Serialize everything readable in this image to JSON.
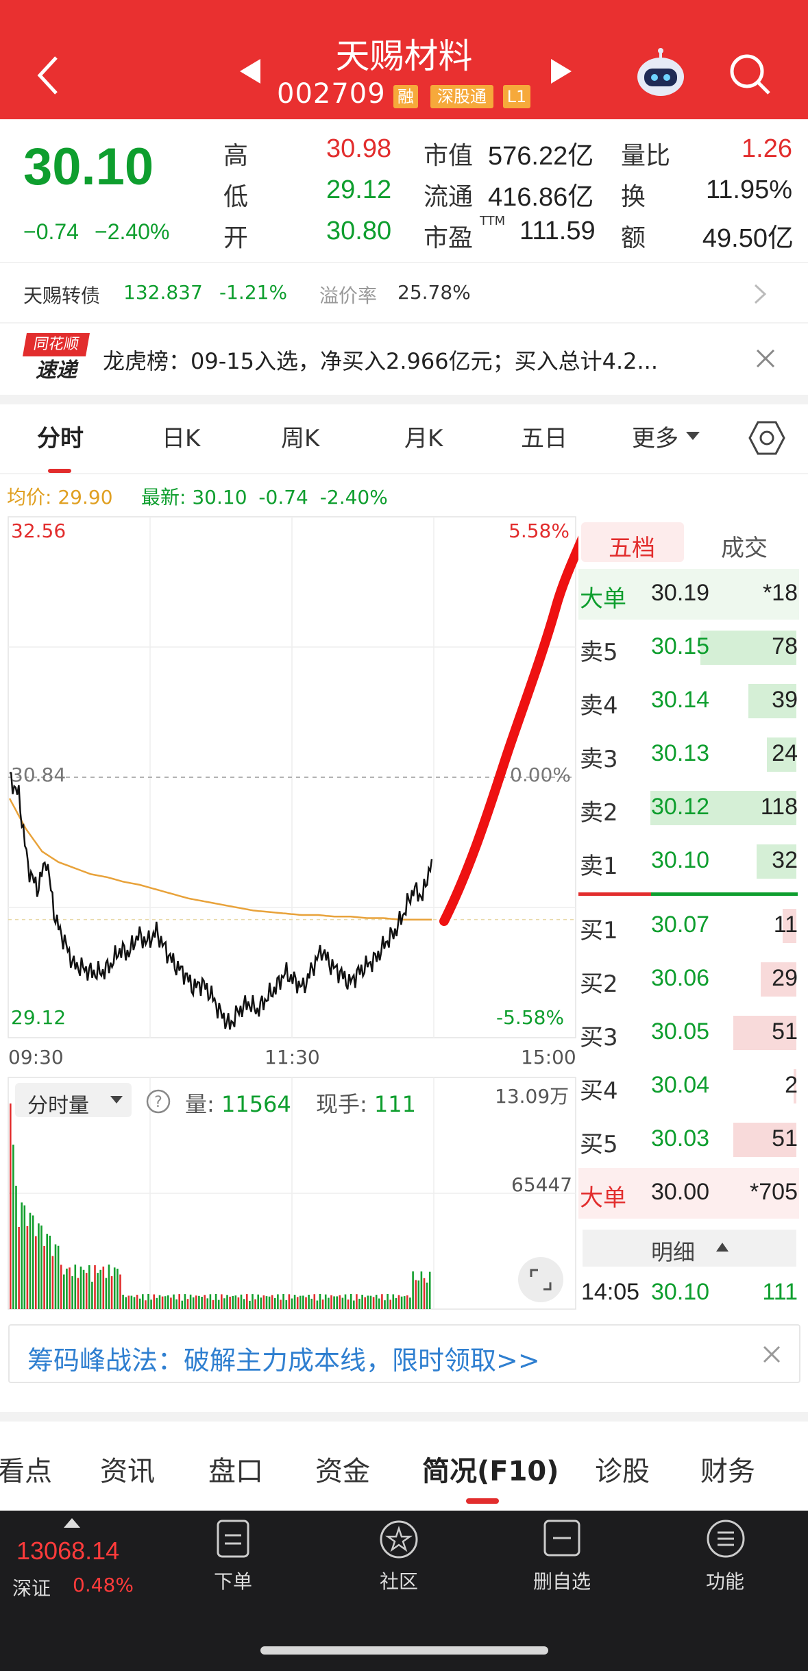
{
  "header": {
    "title": "天赐材料",
    "code": "002709",
    "tags": [
      "融",
      "深股通",
      "L1"
    ],
    "colors": {
      "bg": "#e93030",
      "tag": "#f6a93b"
    }
  },
  "quote": {
    "price": "30.10",
    "change": "−0.74",
    "change_pct": "−2.40%",
    "high_label": "高",
    "high": "30.98",
    "low_label": "低",
    "low": "29.12",
    "open_label": "开",
    "open": "30.80",
    "mcap_label": "市值",
    "mcap": "576.22亿",
    "float_label": "流通",
    "float": "416.86亿",
    "pe_label": "市盈",
    "pe_sup": "TTM",
    "pe": "111.59",
    "vol_ratio_label": "量比",
    "vol_ratio": "1.26",
    "turnover_label": "换",
    "turnover": "11.95%",
    "amount_label": "额",
    "amount": "49.50亿"
  },
  "bond": {
    "name": "天赐转债",
    "price": "132.837",
    "pct": "-1.21%",
    "premium_label": "溢价率",
    "premium": "25.78%"
  },
  "news": {
    "badge_line1": "同花顺",
    "badge_line2": "速递",
    "text": "龙虎榜：09-15入选，净买入2.966亿元；买入总计4.2..."
  },
  "tabs": [
    "分时",
    "日K",
    "周K",
    "月K",
    "五日",
    "更多"
  ],
  "chart_info": {
    "avg_label": "均价:",
    "avg": "29.90",
    "latest_label": "最新:",
    "latest": "30.10",
    "chg": "-0.74",
    "pct": "-2.40%"
  },
  "chart_data": {
    "type": "line",
    "y_top": "32.56",
    "y_mid": "30.84",
    "y_bottom": "29.12",
    "pct_top": "5.58%",
    "pct_mid": "0.00%",
    "pct_bottom": "-5.58%",
    "ylim": [
      29.12,
      32.56
    ],
    "x_ticks": [
      "09:30",
      "11:30",
      "15:00"
    ],
    "price_series": [
      30.84,
      30.72,
      30.25,
      30.1,
      30.3,
      29.9,
      29.75,
      29.6,
      29.58,
      29.55,
      29.55,
      29.6,
      29.7,
      29.68,
      29.8,
      29.75,
      29.82,
      29.7,
      29.6,
      29.55,
      29.45,
      29.48,
      29.4,
      29.28,
      29.2,
      29.3,
      29.35,
      29.3,
      29.38,
      29.45,
      29.55,
      29.5,
      29.45,
      29.58,
      29.7,
      29.6,
      29.55,
      29.48,
      29.55,
      29.6,
      29.65,
      29.75,
      29.82,
      29.95,
      30.1,
      30.05,
      30.3
    ],
    "avg_series": [
      30.7,
      30.5,
      30.35,
      30.28,
      30.24,
      30.2,
      30.18,
      30.15,
      30.13,
      30.1,
      30.07,
      30.04,
      30.02,
      30.0,
      29.98,
      29.96,
      29.95,
      29.94,
      29.93,
      29.93,
      29.92,
      29.92,
      29.91,
      29.91,
      29.9,
      29.9,
      29.9
    ]
  },
  "volume": {
    "selector": "分时量",
    "vol_label": "量:",
    "vol": "11564",
    "hand_label": "现手:",
    "hand": "111",
    "max_label": "13.09万",
    "mid_label": "65447"
  },
  "order_book": {
    "tab_active": "五档",
    "tab_other": "成交",
    "big_sell": {
      "label": "大单",
      "price": "30.19",
      "vol": "*18"
    },
    "asks": [
      {
        "label": "卖5",
        "price": "30.15",
        "vol": "78"
      },
      {
        "label": "卖4",
        "price": "30.14",
        "vol": "39"
      },
      {
        "label": "卖3",
        "price": "30.13",
        "vol": "24"
      },
      {
        "label": "卖2",
        "price": "30.12",
        "vol": "118"
      },
      {
        "label": "卖1",
        "price": "30.10",
        "vol": "32"
      }
    ],
    "bids": [
      {
        "label": "买1",
        "price": "30.07",
        "vol": "11"
      },
      {
        "label": "买2",
        "price": "30.06",
        "vol": "29"
      },
      {
        "label": "买3",
        "price": "30.05",
        "vol": "51"
      },
      {
        "label": "买4",
        "price": "30.04",
        "vol": "2"
      },
      {
        "label": "买5",
        "price": "30.03",
        "vol": "51"
      }
    ],
    "big_buy": {
      "label": "大单",
      "price": "30.00",
      "vol": "*705"
    },
    "detail_label": "明细",
    "last_trade": {
      "time": "14:05",
      "price": "30.10",
      "vol": "111"
    }
  },
  "promo": {
    "text": "筹码峰战法：破解主力成本线，限时领取>>"
  },
  "bottom_tabs": [
    "看点",
    "资讯",
    "盘口",
    "资金",
    "简况(F10)",
    "诊股",
    "财务"
  ],
  "footer": {
    "index_value": "13068.14",
    "index_name": "深证",
    "index_pct": "0.48%",
    "actions": [
      "下单",
      "社区",
      "删自选",
      "功能"
    ]
  }
}
